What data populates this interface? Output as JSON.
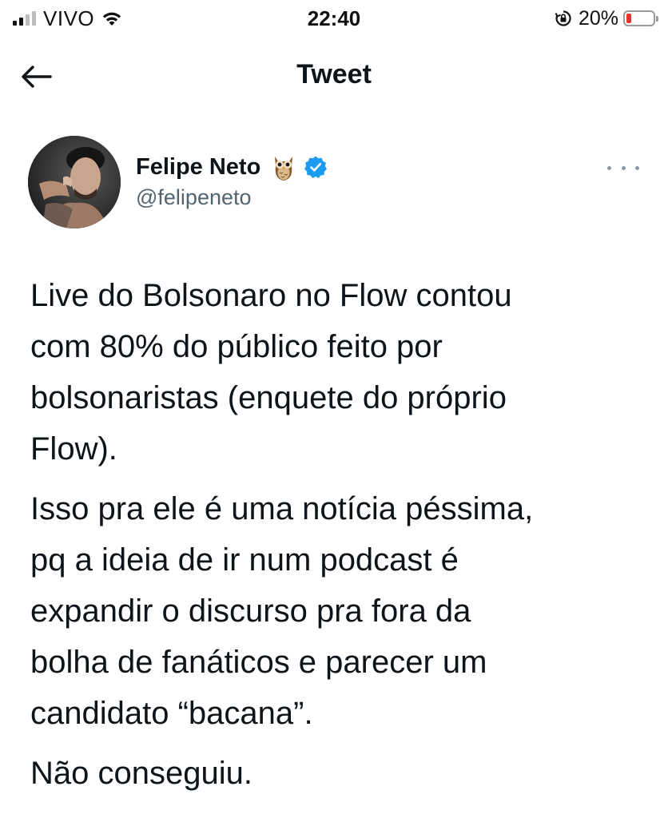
{
  "status_bar": {
    "carrier": "VIVO",
    "time": "22:40",
    "battery_percent": "20%",
    "battery_level": 0.2,
    "battery_color": "#e8332c"
  },
  "header": {
    "title": "Tweet",
    "back_icon": "arrow-left-icon"
  },
  "tweet": {
    "author_name": "Felipe Neto",
    "author_handle": "@felipeneto",
    "name_emoji_icon": "owl-icon",
    "verified": true,
    "verified_color": "#1d9bf0",
    "more_icon": "more-options-icon",
    "paragraphs": [
      {
        "lines": [
          "Live do Bolsonaro no Flow contou",
          "com 80% do público feito por",
          "bolsonaristas (enquete do próprio",
          "Flow)."
        ]
      },
      {
        "lines": [
          "Isso pra ele é uma notícia péssima,",
          "pq a ideia de ir num podcast é",
          "expandir o discurso pra fora da",
          "bolha de fanáticos e parecer um",
          "candidato “bacana”."
        ]
      },
      {
        "lines": [
          "Não conseguiu."
        ]
      }
    ]
  }
}
